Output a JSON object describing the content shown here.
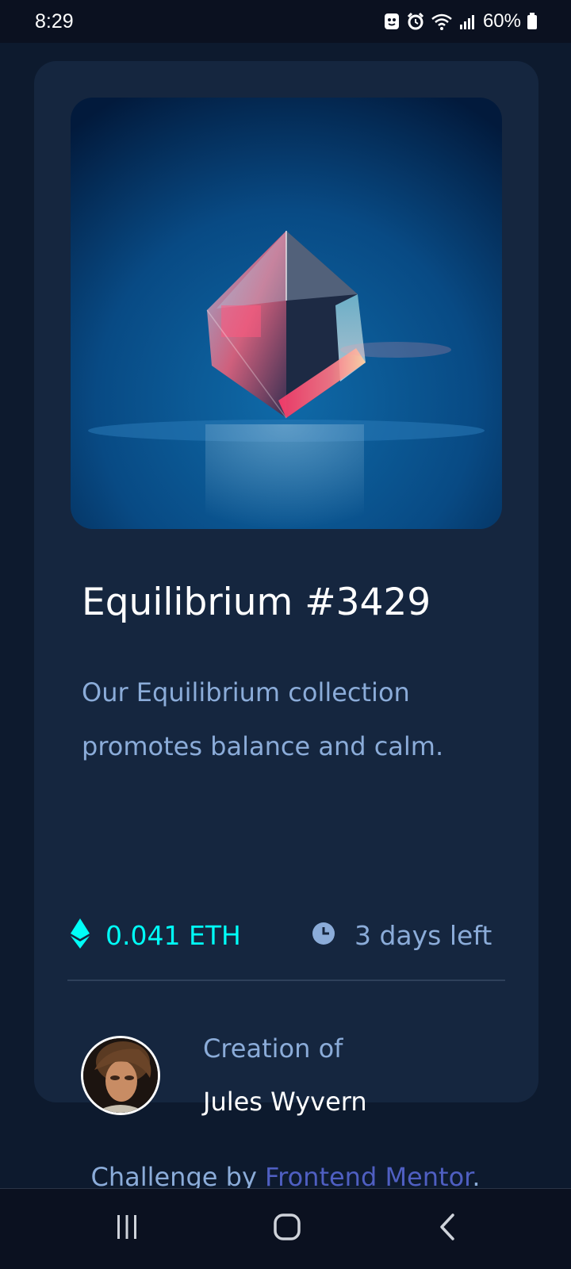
{
  "status_bar": {
    "time": "8:29",
    "battery": "60%",
    "icons": [
      "notification-icon",
      "alarm-icon",
      "wifi-icon",
      "signal-icon",
      "battery-icon"
    ]
  },
  "card": {
    "image_icon": "cube-artwork-image",
    "title": "Equilibrium #3429",
    "description": "Our Equilibrium collection promotes balance and calm.",
    "price": "0.041 ETH",
    "price_icon": "ethereum-icon",
    "time_left": "3 days left",
    "time_icon": "clock-icon",
    "creation_label": "Creation of",
    "creator_name": "Jules Wyvern"
  },
  "attribution": {
    "prefix": "Challenge by ",
    "link_text": "Frontend Mentor",
    "suffix": "."
  },
  "nav_bar": {
    "buttons": [
      "recent-apps-icon",
      "home-icon",
      "back-icon"
    ]
  },
  "colors": {
    "page_bg": "#0d1a2e",
    "card_bg": "#15263f",
    "accent_cyan": "#00fff8",
    "soft_blue": "#8bacd9",
    "link": "#4f5fc2",
    "white": "#ffffff"
  }
}
